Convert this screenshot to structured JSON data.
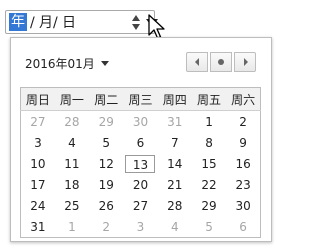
{
  "date_input": {
    "year_seg": "年",
    "sep1": "/",
    "month_seg": "月",
    "sep2": "/",
    "day_seg": "日"
  },
  "picker": {
    "month_label": "2016年01月",
    "weekdays": [
      "周日",
      "周一",
      "周二",
      "周三",
      "周四",
      "周五",
      "周六"
    ],
    "weeks": [
      [
        "27",
        "28",
        "29",
        "30",
        "31",
        "1",
        "2"
      ],
      [
        "3",
        "4",
        "5",
        "6",
        "7",
        "8",
        "9"
      ],
      [
        "10",
        "11",
        "12",
        "13",
        "14",
        "15",
        "16"
      ],
      [
        "17",
        "18",
        "19",
        "20",
        "21",
        "22",
        "23"
      ],
      [
        "24",
        "25",
        "26",
        "27",
        "28",
        "29",
        "30"
      ],
      [
        "31",
        "1",
        "2",
        "3",
        "4",
        "5",
        "6"
      ]
    ],
    "today": "13"
  },
  "colors": {
    "selection": "#3478d6",
    "muted_day": "#a6a6a6"
  }
}
